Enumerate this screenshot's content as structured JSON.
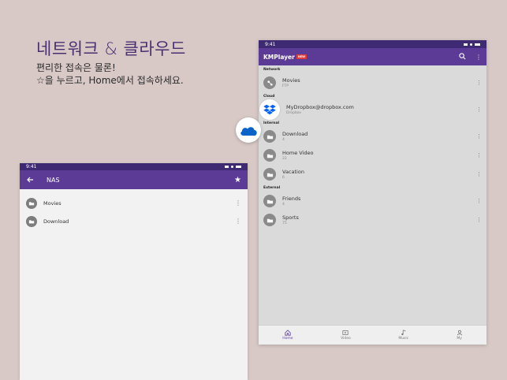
{
  "promo": {
    "headline": "네트워크 & 클라우드",
    "sub_line1": "편리한 접속은 물론!",
    "sub_line2": "☆을 누르고, Home에서 접속하세요."
  },
  "phone_left": {
    "time": "9:41",
    "title": "NAS",
    "items": [
      {
        "label": "Movies"
      },
      {
        "label": "Download"
      }
    ]
  },
  "tablet": {
    "time": "9:41",
    "logo_text": "KMPlayer",
    "logo_badge": "NEW",
    "sections": {
      "network": "Network",
      "cloud": "Cloud",
      "internal": "Internal",
      "external": "External"
    },
    "network_items": [
      {
        "title": "Movies",
        "sub": "FTP"
      }
    ],
    "cloud_items": [
      {
        "title": "MyDropbox@dropbox.com",
        "sub": "Dropbox"
      }
    ],
    "internal_items": [
      {
        "title": "Download",
        "sub": "4"
      },
      {
        "title": "Home Video",
        "sub": "22"
      },
      {
        "title": "Vacation",
        "sub": "6"
      }
    ],
    "external_items": [
      {
        "title": "Friends",
        "sub": "4"
      },
      {
        "title": "Sports",
        "sub": "75"
      }
    ],
    "nav": {
      "home": "Home",
      "video": "Video",
      "music": "Music",
      "my": "My"
    }
  },
  "colors": {
    "background": "#d8c9c6",
    "brand_purple": "#5b3b95",
    "status_purple": "#3e2a73",
    "onedrive_blue": "#0a63c8",
    "dropbox_blue": "#0061fe"
  }
}
